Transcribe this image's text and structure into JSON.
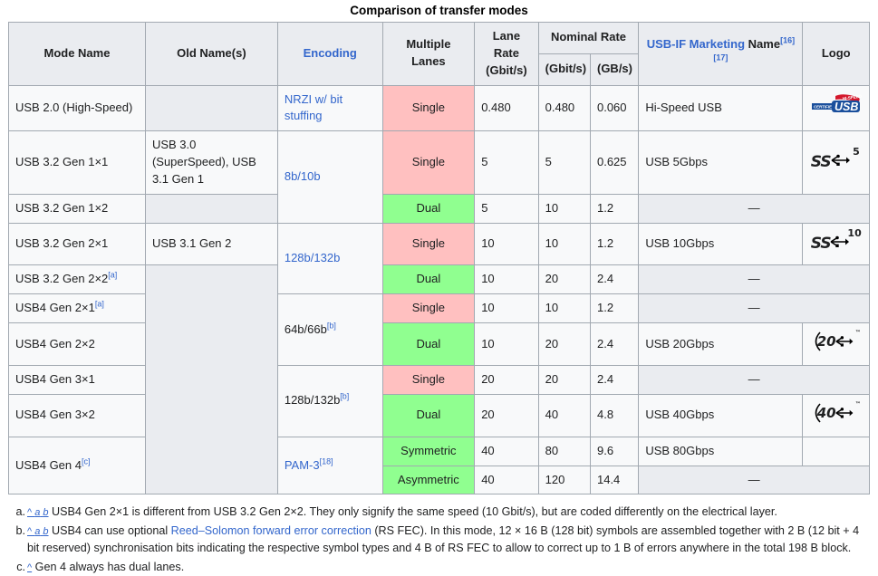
{
  "caption": "Comparison of transfer modes",
  "header": {
    "mode_name": "Mode Name",
    "old_names": "Old Name(s)",
    "encoding": "Encoding",
    "multiple_lanes": "Multiple Lanes",
    "lane_rate": "Lane Rate (Gbit/s)",
    "lane_rate_l1": "Lane",
    "lane_rate_l2": "Rate",
    "lane_rate_l3": "(Gbit/s)",
    "nominal_rate": "Nominal Rate",
    "nominal_gbit": "(Gbit/s)",
    "nominal_gb": "(GB/s)",
    "usbif_marketing": "USB-IF Marketing",
    "usbif_marketing_l2": "Name",
    "usbif_ref1": "[16]",
    "usbif_ref2": "[17]",
    "logo": "Logo"
  },
  "rows": [
    {
      "mode": "USB 2.0 (High-Speed)",
      "old": "",
      "encoding": "NRZI w/ bit stuffing",
      "lanes": "Single",
      "lanes_color": "pink",
      "lane_rate": "0.480",
      "gbit": "0.480",
      "gb": "0.060",
      "marketing": "Hi-Speed USB",
      "logo": "hi-speed-usb-logo"
    },
    {
      "mode": "USB 3.2 Gen 1×1",
      "old": "USB 3.0 (SuperSpeed), USB 3.1 Gen 1",
      "encoding": "8b/10b",
      "lanes": "Single",
      "lanes_color": "pink",
      "lane_rate": "5",
      "gbit": "5",
      "gb": "0.625",
      "marketing": "USB 5Gbps",
      "logo": "superspeed-5-logo"
    },
    {
      "mode": "USB 3.2 Gen 1×2",
      "old": "",
      "encoding": "",
      "lanes": "Dual",
      "lanes_color": "green",
      "lane_rate": "5",
      "gbit": "10",
      "gb": "1.2",
      "marketing": "—",
      "logo": ""
    },
    {
      "mode": "USB 3.2 Gen 2×1",
      "old": "USB 3.1 Gen 2",
      "encoding": "128b/132b",
      "lanes": "Single",
      "lanes_color": "pink",
      "lane_rate": "10",
      "gbit": "10",
      "gb": "1.2",
      "marketing": "USB 10Gbps",
      "logo": "superspeed-10-logo"
    },
    {
      "mode": "USB 3.2 Gen 2×2",
      "mode_ref": "[a]",
      "old": "",
      "encoding": "",
      "lanes": "Dual",
      "lanes_color": "green",
      "lane_rate": "10",
      "gbit": "20",
      "gb": "2.4",
      "marketing": "—",
      "logo": ""
    },
    {
      "mode": "USB4 Gen 2×1",
      "mode_ref": "[a]",
      "old": "",
      "encoding": "64b/66b",
      "encoding_ref": "[b]",
      "lanes": "Single",
      "lanes_color": "pink",
      "lane_rate": "10",
      "gbit": "10",
      "gb": "1.2",
      "marketing": "—",
      "logo": ""
    },
    {
      "mode": "USB4 Gen 2×2",
      "old": "",
      "encoding": "",
      "lanes": "Dual",
      "lanes_color": "green",
      "lane_rate": "10",
      "gbit": "20",
      "gb": "2.4",
      "marketing": "USB 20Gbps",
      "logo": "usb-20-logo"
    },
    {
      "mode": "USB4 Gen 3×1",
      "old": "",
      "encoding": "128b/132b",
      "encoding_ref": "[b]",
      "lanes": "Single",
      "lanes_color": "pink",
      "lane_rate": "20",
      "gbit": "20",
      "gb": "2.4",
      "marketing": "—",
      "logo": ""
    },
    {
      "mode": "USB4 Gen 3×2",
      "old": "",
      "encoding": "",
      "lanes": "Dual",
      "lanes_color": "green",
      "lane_rate": "20",
      "gbit": "40",
      "gb": "4.8",
      "marketing": "USB 40Gbps",
      "logo": "usb-40-logo"
    },
    {
      "mode": "USB4 Gen 4",
      "mode_ref": "[c]",
      "old": "",
      "encoding": "PAM-3",
      "encoding_ref": "[18]",
      "lanes": "Symmetric",
      "lanes_color": "green",
      "lane_rate": "40",
      "gbit": "80",
      "gb": "9.6",
      "marketing": "USB 80Gbps",
      "logo": ""
    },
    {
      "mode": "",
      "old": "",
      "encoding": "",
      "lanes": "Asymmetric",
      "lanes_color": "green",
      "lane_rate": "40",
      "gbit": "120",
      "gb": "14.4",
      "marketing": "—",
      "logo": ""
    }
  ],
  "footnotes": [
    {
      "marker": "a.",
      "backrefs": "^ a b",
      "text": "USB4 Gen 2×1 is different from USB 3.2 Gen 2×2. They only signify the same speed (10 Gbit/s), but are coded differently on the electrical layer."
    },
    {
      "marker": "b.",
      "backrefs": "^ a b",
      "text_pre": "USB4 can use optional ",
      "link": "Reed–Solomon forward error correction",
      "text_post": " (RS FEC). In this mode, 12 × 16 B (128 bit) symbols are assembled together with 2 B (12 bit + 4 bit reserved) synchronisation bits indicating the respective symbol types and 4 B of RS FEC to allow to correct up to 1 B of errors anywhere in the total 198 B block."
    },
    {
      "marker": "c.",
      "backrefs": "^",
      "text": "Gen 4 always has dual lanes."
    }
  ],
  "colors": {
    "header_bg": "#eaecf0",
    "border": "#a2a9b1",
    "single_lane": "#ffc0c0",
    "dual_lane": "#90ff90",
    "link": "#3366cc",
    "empty_cell": "#eaecf0"
  }
}
